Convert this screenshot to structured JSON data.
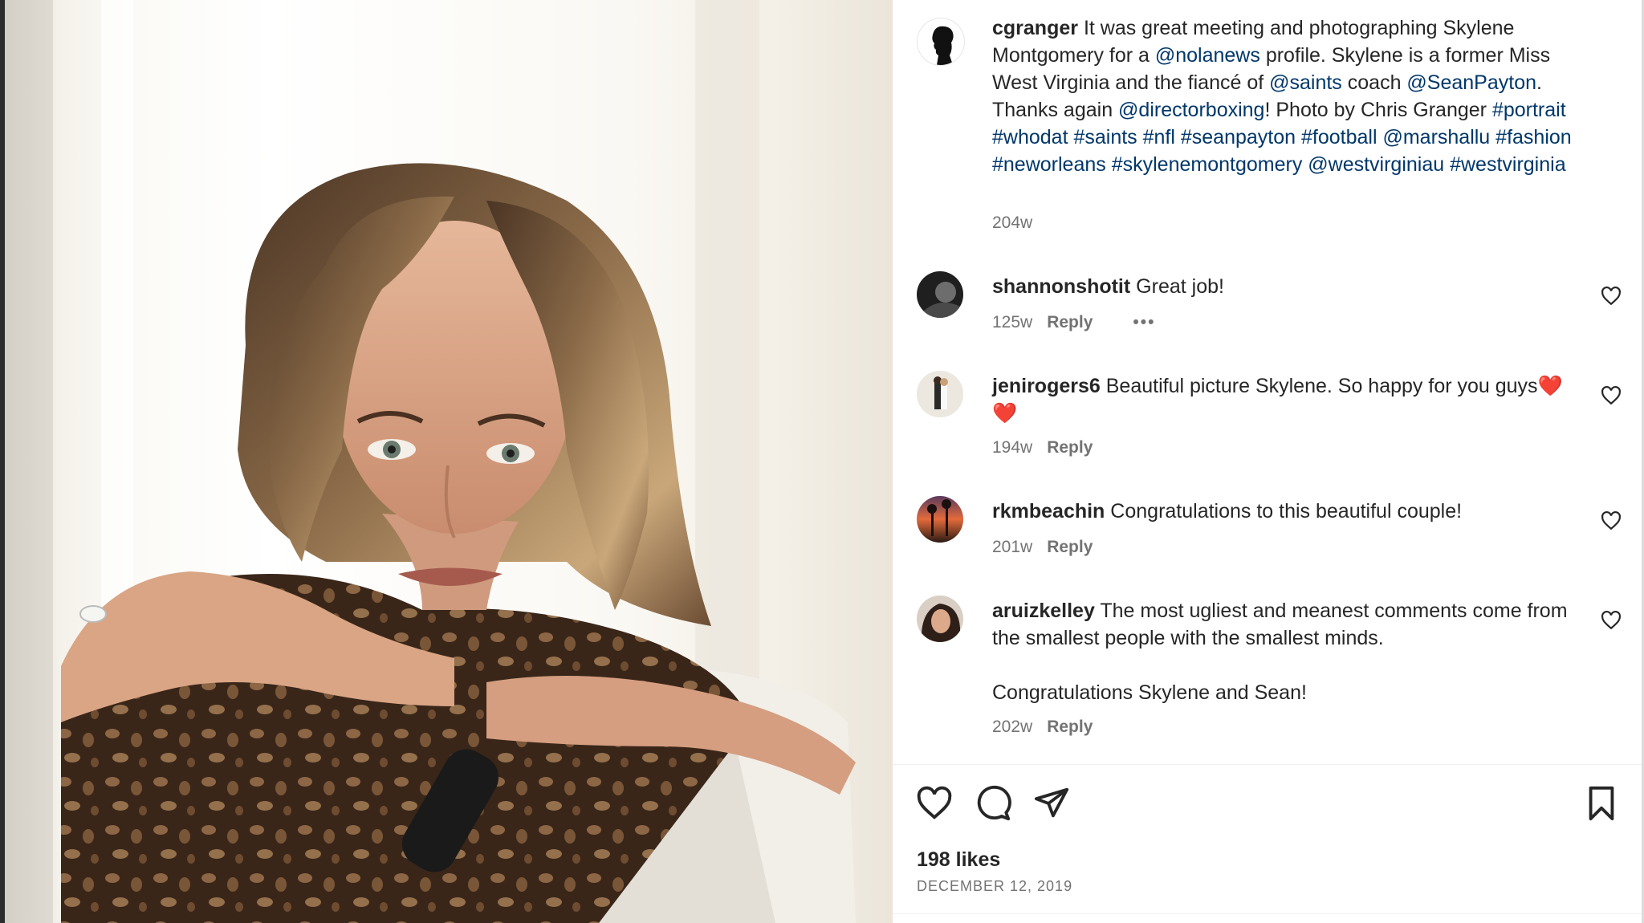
{
  "post": {
    "author": "cgranger",
    "caption_segments": [
      {
        "t": "It was great meeting and photographing Skylene Montgomery for a ",
        "link": false
      },
      {
        "t": "@nolanews",
        "link": true
      },
      {
        "t": " profile. Skylene is a former Miss West Virginia and the fiancé of ",
        "link": false
      },
      {
        "t": "@saints",
        "link": true
      },
      {
        "t": " coach ",
        "link": false
      },
      {
        "t": "@SeanPayton",
        "link": true
      },
      {
        "t": ". Thanks again ",
        "link": false
      },
      {
        "t": "@directorboxing",
        "link": true
      },
      {
        "t": "! Photo by Chris Granger ",
        "link": false
      },
      {
        "t": "#portrait #whodat #saints #nfl #seanpayton #football @marshallu #fashion #neworleans #skylenemontgomery @westvirginiau #westvirginia",
        "link": true
      }
    ],
    "time": "204w"
  },
  "comments": [
    {
      "user": "shannonshotit",
      "text": "Great job!",
      "time": "125w",
      "reply": "Reply",
      "more": "•••",
      "avatar_color": "#2a2a2a"
    },
    {
      "user": "jenirogers6",
      "text": "Beautiful picture Skylene. So happy for you guys❤️❤️",
      "time": "194w",
      "reply": "Reply",
      "avatar_color": "#e9e4dc"
    },
    {
      "user": "rkmbeachin",
      "text": "Congratulations to this beautiful couple!",
      "time": "201w",
      "reply": "Reply",
      "avatar_color": "#c0602e"
    },
    {
      "user": "aruizkelley",
      "text": "The most ugliest and meanest comments come from the smallest people with the smallest minds.",
      "text2": "Congratulations Skylene and Sean!",
      "time": "202w",
      "reply": "Reply",
      "avatar_color": "#3a2a22"
    }
  ],
  "footer": {
    "likes": "198 likes",
    "date": "DECEMBER 12, 2019"
  },
  "icons": {
    "like": "heart-icon",
    "comment": "comment-bubble-icon",
    "share": "paper-plane-icon",
    "save": "bookmark-icon",
    "comment_like": "heart-outline-icon"
  }
}
